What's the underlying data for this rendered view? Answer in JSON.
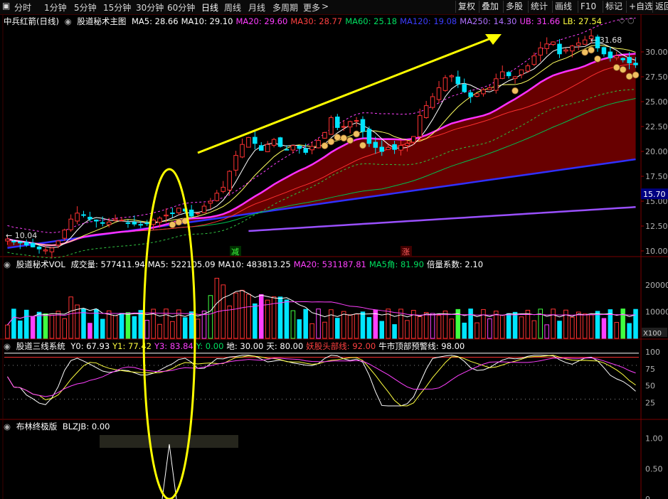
{
  "toolbar": {
    "collapse_icon": "collapse-icon",
    "periods": [
      "分时",
      "1分钟",
      "5分钟",
      "15分钟",
      "30分钟",
      "60分钟",
      "日线",
      "周线",
      "月线",
      "多周期",
      "更多"
    ],
    "active_period": "日线",
    "more_arrow": ">",
    "right_buttons": [
      "复权",
      "叠加",
      "多股",
      "统计",
      "画线",
      "F10",
      "标记",
      "+自选",
      "返回"
    ]
  },
  "main_panel": {
    "stock_name": "中兵红箭(日线)",
    "indicator_name": "股道秘术主图",
    "readouts": [
      {
        "label": "MA5: 28.66",
        "color": "#ffffff"
      },
      {
        "label": "MA10: 29.10",
        "color": "#ffffff"
      },
      {
        "label": "MA20: 29.60",
        "color": "#ff3cff"
      },
      {
        "label": "MA30: 28.77",
        "color": "#ff4040"
      },
      {
        "label": "MA60: 25.18",
        "color": "#00e060"
      },
      {
        "label": "MA120: 19.08",
        "color": "#3c3cff"
      },
      {
        "label": "MA250: 14.30",
        "color": "#b070ff"
      },
      {
        "label": "UB: 31.66",
        "color": "#ff40ff"
      },
      {
        "label": "LB: 27.54",
        "color": "#ffff40"
      }
    ],
    "y_axis_ticks": [
      "30.00",
      "27.50",
      "25.00",
      "22.50",
      "20.00",
      "17.50",
      "15.00",
      "12.50",
      "10.00"
    ],
    "current_price_tag": "15.70",
    "high_annotation": "31.68",
    "low_annotation": "10.04",
    "signal_down": "减",
    "signal_up": "涨"
  },
  "vol_panel": {
    "indicator_name": "股道秘术VOL",
    "readouts": [
      {
        "label": "成交量: 577411.94",
        "color": "#ffffff"
      },
      {
        "label": "MA5: 522105.09",
        "color": "#ffffff"
      },
      {
        "label": "MA10: 483813.25",
        "color": "#ffffff"
      },
      {
        "label": "MA20: 531187.81",
        "color": "#ff40ff"
      },
      {
        "label": "MA5角: 81.90",
        "color": "#00e060"
      },
      {
        "label": "倍量系数: 2.10",
        "color": "#ffffff"
      }
    ],
    "y_axis_ticks": [
      "20000",
      "10000"
    ],
    "unit_tag": "X100"
  },
  "three_line_panel": {
    "indicator_name": "股道三线系统",
    "readouts": [
      {
        "label": "Y0: 67.93",
        "color": "#ffffff"
      },
      {
        "label": "Y1: 77.42",
        "color": "#ffff40"
      },
      {
        "label": "Y3: 83.84",
        "color": "#ff40ff"
      },
      {
        "label": "Y: 0.00",
        "color": "#00e060"
      },
      {
        "label": "地: 30.00",
        "color": "#ffffff"
      },
      {
        "label": "天: 80.00",
        "color": "#ffffff"
      },
      {
        "label": "妖股头部线: 92.00",
        "color": "#ff4040"
      },
      {
        "label": "牛市顶部预警线: 98.00",
        "color": "#ffffff"
      }
    ],
    "y_axis_ticks": [
      "100",
      "75",
      "50",
      "25"
    ]
  },
  "boll_panel": {
    "indicator_name": "布林终极版",
    "readouts": [
      {
        "label": "BLZJB: 0.00",
        "color": "#ffffff"
      }
    ],
    "y_axis_ticks": [
      "1.00",
      "0.50",
      "0"
    ]
  },
  "colors": {
    "up_candle": "#ff3232",
    "down_candle": "#00e5ff",
    "annotation_yellow": "#ffff00",
    "ribbon_fill": "#7a0000",
    "money_bag": "#f0c060"
  },
  "chart_data": [
    {
      "type": "candlestick",
      "title": "中兵红箭(日线)",
      "ylim": [
        9.5,
        32.5
      ],
      "n_bars": 100,
      "trend": "price rises from about 10.0 to a peak of 31.68, then eases to about 28.7",
      "highlight_close": [
        11.2,
        10.9,
        10.8,
        10.6,
        10.4,
        10.2,
        10.1,
        10.3,
        11.0,
        12.1,
        13.2,
        13.8,
        13.6,
        13.2,
        13.0,
        12.8,
        12.9,
        13.2,
        13.1,
        12.8,
        12.7,
        12.6,
        12.8,
        13.1,
        13.3,
        13.6,
        13.8,
        14.3,
        14.0,
        13.5,
        13.8,
        14.5,
        15.0,
        15.8,
        16.4,
        18.0,
        19.6,
        20.7,
        21.4,
        20.8,
        20.1,
        20.7,
        21.2,
        20.5,
        20.2,
        20.6,
        20.3,
        19.9,
        20.5,
        21.1,
        21.9,
        23.4,
        22.4,
        22.5,
        23.0,
        23.1,
        22.0,
        20.8,
        20.4,
        20.0,
        20.4,
        20.2,
        20.6,
        20.8,
        21.5,
        23.6,
        24.6,
        25.5,
        26.4,
        27.4,
        27.6,
        26.8,
        26.0,
        25.5,
        25.8,
        26.2,
        26.4,
        27.3,
        28.0,
        27.6,
        27.5,
        28.2,
        28.6,
        29.6,
        30.4,
        30.8,
        31.0,
        29.8,
        30.2,
        30.6,
        30.9,
        31.2,
        31.6,
        30.4,
        29.8,
        29.4,
        29.6,
        29.2,
        28.9,
        28.7
      ]
    },
    {
      "type": "bar",
      "title": "股道秘术VOL",
      "ylim": [
        0,
        25000
      ],
      "n_bars": 100
    },
    {
      "type": "line",
      "title": "股道三线系统",
      "ylim": [
        0,
        100
      ],
      "series": [
        {
          "name": "Y0",
          "color": "#ffffff"
        },
        {
          "name": "Y1",
          "color": "#ffff40"
        },
        {
          "name": "Y3",
          "color": "#ff40ff"
        }
      ]
    },
    {
      "type": "line",
      "title": "布林终极版",
      "ylim": [
        0,
        1
      ],
      "series": [
        {
          "name": "BLZJB",
          "color": "#ffffff"
        }
      ]
    }
  ]
}
